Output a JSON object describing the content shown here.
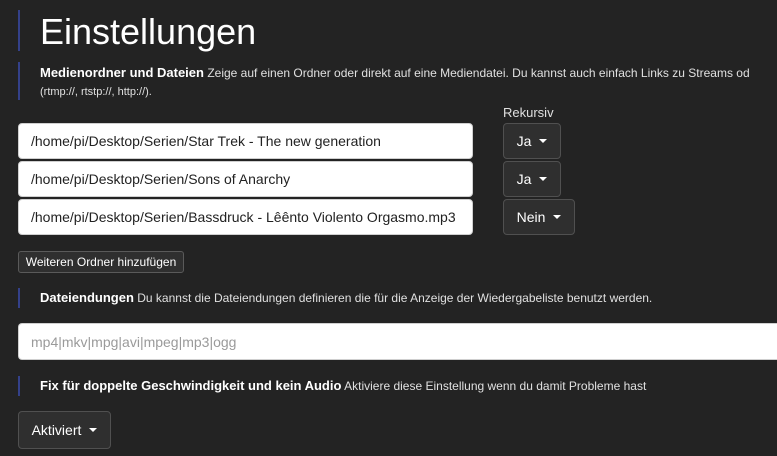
{
  "page": {
    "title": "Einstellungen"
  },
  "media": {
    "heading": "Medienordner und Dateien",
    "description_line1": "Zeige auf einen Ordner oder direkt auf eine Mediendatei. Du kannst auch einfach Links zu Streams od",
    "description_line2": "(rtmp://, rtstp://, http://).",
    "recursive_label": "Rekursiv",
    "entries": [
      {
        "path": "/home/pi/Desktop/Serien/Star Trek - The new generation",
        "recursive": "Ja"
      },
      {
        "path": "/home/pi/Desktop/Serien/Sons of Anarchy",
        "recursive": "Ja"
      },
      {
        "path": "/home/pi/Desktop/Serien/Bassdruck - Lêênto Violento Orgasmo.mp3",
        "recursive": "Nein"
      }
    ],
    "add_button": "Weiteren Ordner hinzufügen"
  },
  "extensions": {
    "heading": "Dateiendungen",
    "description": "Du kannst die Dateiendungen definieren die für die Anzeige der Wiedergabeliste benutzt werden.",
    "placeholder": "mp4|mkv|mpg|avi|mpeg|mp3|ogg"
  },
  "fix": {
    "heading": "Fix für doppelte Geschwindigkeit und kein Audio",
    "description": "Aktiviere diese Einstellung wenn du damit Probleme hast",
    "value": "Aktiviert"
  }
}
